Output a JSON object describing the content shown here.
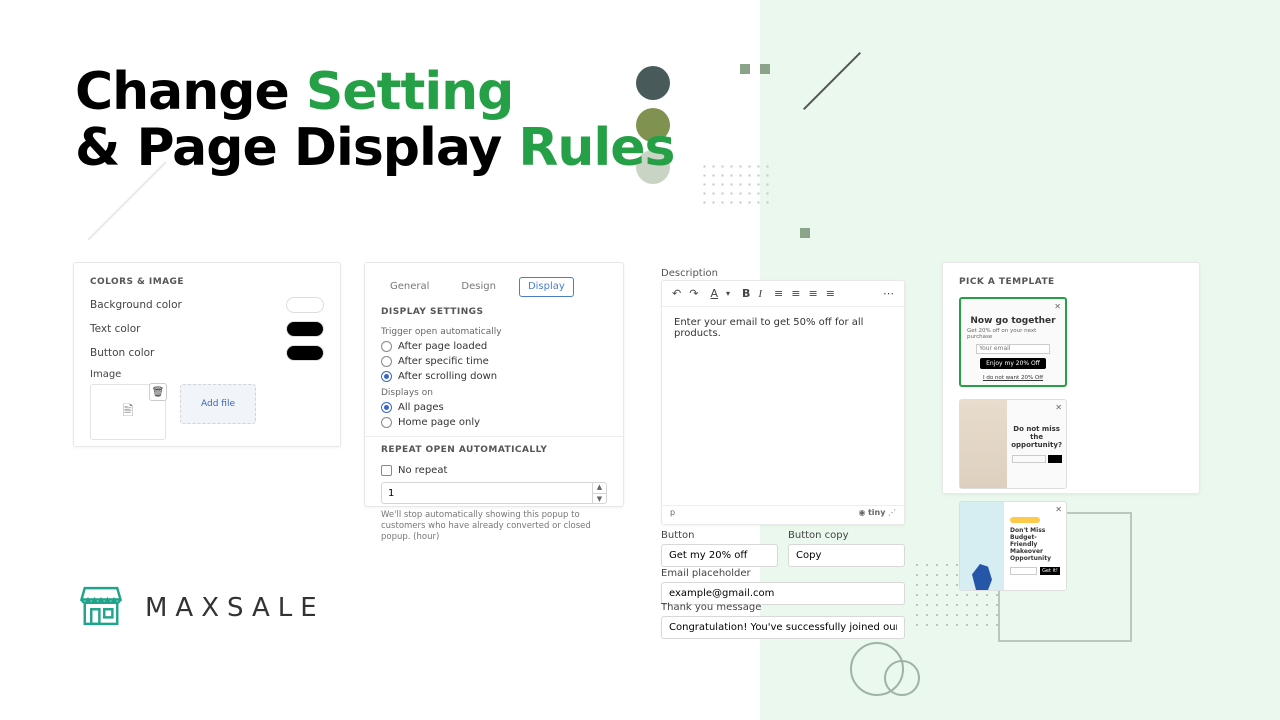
{
  "hero": {
    "l1a": "Change ",
    "l1b": "Setting",
    "l2a": "& Page Display ",
    "l2b": "Rules"
  },
  "brand": {
    "name": "MAXSALE"
  },
  "card1": {
    "title": "COLORS & IMAGE",
    "bg_label": "Background color",
    "text_label": "Text color",
    "btn_label": "Button color",
    "img_label": "Image",
    "addfile": "Add file"
  },
  "card2": {
    "tabs": {
      "general": "General",
      "design": "Design",
      "display": "Display"
    },
    "settings_title": "DISPLAY SETTINGS",
    "trigger_label": "Trigger open automatically",
    "trigger_opts": {
      "loaded": "After page loaded",
      "time": "After specific time",
      "scroll": "After scrolling down"
    },
    "displays_label": "Displays on",
    "displays_opts": {
      "all": "All pages",
      "home": "Home page only"
    },
    "repeat_title": "REPEAT OPEN AUTOMATICALLY",
    "no_repeat": "No repeat",
    "repeat_value": "1",
    "hint": "We'll stop automatically showing this popup to customers who have already converted or closed popup. (hour)"
  },
  "editor": {
    "desc_label": "Description",
    "body": "Enter your email to get 50% off for all products.",
    "path": "p",
    "brand": "tiny",
    "button_label": "Button",
    "button_value": "Get my 20% off",
    "copy_label": "Button copy",
    "copy_value": "Copy",
    "email_label": "Email placeholder",
    "email_value": "example@gmail.com",
    "thanks_label": "Thank you message",
    "thanks_value": "Congratulation! You've successfully joined our list. Stay tuned for future upc"
  },
  "templates": {
    "title": "PICK A TEMPLATE",
    "t1": {
      "title": "Now go together",
      "sub": "Get 20% off on your next purchase",
      "placeholder": "Your email",
      "btn": "Enjoy my 20% Off",
      "under": "I do not want 20% Off"
    },
    "t2": {
      "title": "Do not miss the opportunity?",
      "placeholder": "",
      "btn": ""
    },
    "t3": {
      "line1": "Don't Miss Budget-Friendly",
      "line2": "Makeover Opportunity",
      "btn": "Get it!"
    }
  }
}
